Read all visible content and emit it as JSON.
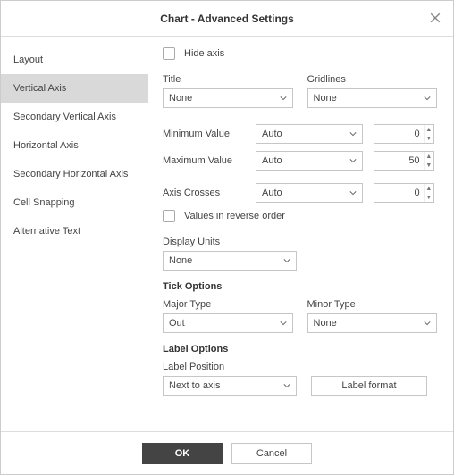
{
  "title": "Chart - Advanced Settings",
  "sidebar": {
    "items": [
      {
        "label": "Layout"
      },
      {
        "label": "Vertical Axis"
      },
      {
        "label": "Secondary Vertical Axis"
      },
      {
        "label": "Horizontal Axis"
      },
      {
        "label": "Secondary Horizontal Axis"
      },
      {
        "label": "Cell Snapping"
      },
      {
        "label": "Alternative Text"
      }
    ]
  },
  "form": {
    "hide_axis_label": "Hide axis",
    "title_label": "Title",
    "title_value": "None",
    "gridlines_label": "Gridlines",
    "gridlines_value": "None",
    "min_label": "Minimum Value",
    "min_select": "Auto",
    "min_value": "0",
    "max_label": "Maximum Value",
    "max_select": "Auto",
    "max_value": "50",
    "cross_label": "Axis Crosses",
    "cross_select": "Auto",
    "cross_value": "0",
    "reverse_label": "Values in reverse order",
    "units_label": "Display Units",
    "units_value": "None",
    "tick_section": "Tick Options",
    "major_label": "Major Type",
    "major_value": "Out",
    "minor_label": "Minor Type",
    "minor_value": "None",
    "label_section": "Label Options",
    "labelpos_label": "Label Position",
    "labelpos_value": "Next to axis",
    "format_btn": "Label format"
  },
  "footer": {
    "ok": "OK",
    "cancel": "Cancel"
  }
}
